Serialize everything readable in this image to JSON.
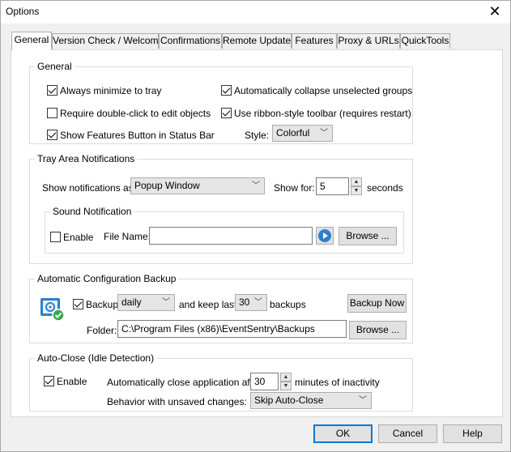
{
  "window": {
    "title": "Options",
    "close_glyph": "✕"
  },
  "tabs": [
    {
      "label": "General"
    },
    {
      "label": "Version Check / Welcome"
    },
    {
      "label": "Confirmations"
    },
    {
      "label": "Remote Update"
    },
    {
      "label": "Features"
    },
    {
      "label": "Proxy & URLs"
    },
    {
      "label": "QuickTools"
    }
  ],
  "general": {
    "group_label": "General",
    "always_minimize": {
      "label": "Always minimize to tray",
      "checked": true
    },
    "require_double_click": {
      "label": "Require double-click to edit objects",
      "checked": false
    },
    "show_features_button": {
      "label": "Show Features Button in Status Bar",
      "checked": true
    },
    "auto_collapse": {
      "label": "Automatically collapse unselected groups",
      "checked": true
    },
    "ribbon_toolbar": {
      "label": "Use ribbon-style toolbar (requires restart)",
      "checked": true
    },
    "style_label": "Style:",
    "style_value": "Colorful"
  },
  "tray": {
    "group_label": "Tray Area Notifications",
    "show_as_label": "Show notifications as:",
    "show_as_value": "Popup Window",
    "show_for_label": "Show for:",
    "show_for_value": "5",
    "seconds_label": "seconds",
    "sound": {
      "group_label": "Sound Notification",
      "enable_label": "Enable",
      "enable_checked": false,
      "file_name_label": "File Name:",
      "file_name_value": "",
      "browse_label": "Browse ..."
    }
  },
  "backup": {
    "group_label": "Automatic Configuration Backup",
    "backup_label": "Backup",
    "backup_checked": true,
    "frequency_value": "daily",
    "keep_last_label": "and keep last",
    "keep_count_value": "30",
    "backups_label": "backups",
    "backup_now_label": "Backup Now",
    "folder_label": "Folder:",
    "folder_value": "C:\\Program Files (x86)\\EventSentry\\Backups",
    "browse_label": "Browse ..."
  },
  "autoclose": {
    "group_label": "Auto-Close (Idle Detection)",
    "enable_label": "Enable",
    "enable_checked": true,
    "auto_close_label": "Automatically close application after",
    "minutes_value": "30",
    "minutes_label": "minutes of inactivity",
    "behavior_label": "Behavior with unsaved changes:",
    "behavior_value": "Skip Auto-Close"
  },
  "footer": {
    "ok_label": "OK",
    "cancel_label": "Cancel",
    "help_label": "Help"
  },
  "icons": {
    "chevron": "﹀",
    "spin_up": "▲",
    "spin_down": "▼"
  },
  "colors": {
    "accent": "#0078d7",
    "icon_blue": "#2f7fc9",
    "icon_green": "#3aa845"
  }
}
